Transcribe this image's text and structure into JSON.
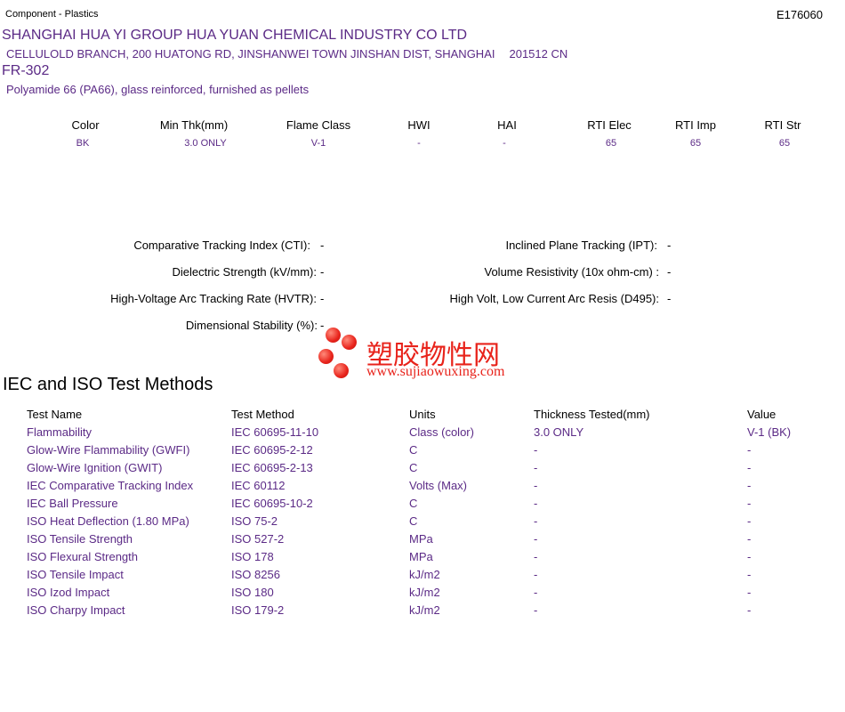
{
  "header": {
    "category": "Component - Plastics",
    "file_number": "E176060"
  },
  "company": {
    "name": "SHANGHAI HUA YI GROUP HUA YUAN CHEMICAL INDUSTRY CO LTD",
    "address": "CELLULOLD BRANCH, 200 HUATONG RD, JINSHANWEI TOWN JINSHAN DIST, SHANGHAI",
    "postal": "201512 CN"
  },
  "product": {
    "grade": "FR-302",
    "description": "Polyamide 66 (PA66), glass reinforced, furnished as pellets"
  },
  "ratings": {
    "headers": [
      "Color",
      "Min Thk(mm)",
      "Flame Class",
      "HWI",
      "HAI",
      "RTI Elec",
      "RTI Imp",
      "RTI Str"
    ],
    "values": [
      "BK",
      "3.0 ONLY",
      "V-1",
      "-",
      "-",
      "65",
      "65",
      "65"
    ]
  },
  "properties": {
    "cti_label": "Comparative Tracking Index (CTI):",
    "cti_value": "-",
    "ipt_label": "Inclined Plane Tracking (IPT):",
    "ipt_value": "-",
    "dielectric_label": "Dielectric Strength (kV/mm):",
    "dielectric_value": "-",
    "volume_label": "Volume Resistivity (10x ohm-cm) :",
    "volume_value": "-",
    "hvtr_label": "High-Voltage Arc Tracking Rate (HVTR):",
    "hvtr_value": "-",
    "d495_label": "High Volt, Low Current Arc Resis (D495):",
    "d495_value": "-",
    "dimensional_label": "Dimensional Stability (%):",
    "dimensional_value": "-"
  },
  "iec_section": {
    "title": "IEC and ISO Test Methods",
    "headers": {
      "name": "Test Name",
      "method": "Test Method",
      "units": "Units",
      "thickness": "Thickness Tested(mm)",
      "value": "Value"
    },
    "rows": [
      {
        "name": "Flammability",
        "method": "IEC 60695-11-10",
        "units": "Class (color)",
        "thickness": "3.0 ONLY",
        "value": "V-1 (BK)"
      },
      {
        "name": "Glow-Wire Flammability (GWFI)",
        "method": "IEC 60695-2-12",
        "units": "C",
        "thickness": "-",
        "value": "-"
      },
      {
        "name": "Glow-Wire Ignition (GWIT)",
        "method": "IEC 60695-2-13",
        "units": "C",
        "thickness": "-",
        "value": "-"
      },
      {
        "name": "IEC Comparative Tracking Index",
        "method": "IEC 60112",
        "units": "Volts (Max)",
        "thickness": "-",
        "value": "-"
      },
      {
        "name": "IEC Ball Pressure",
        "method": "IEC 60695-10-2",
        "units": "C",
        "thickness": "-",
        "value": "-"
      },
      {
        "name": "ISO Heat Deflection (1.80 MPa)",
        "method": "ISO 75-2",
        "units": "C",
        "thickness": "-",
        "value": "-"
      },
      {
        "name": "ISO Tensile Strength",
        "method": "ISO 527-2",
        "units": "MPa",
        "thickness": "-",
        "value": "-"
      },
      {
        "name": "ISO Flexural Strength",
        "method": "ISO 178",
        "units": "MPa",
        "thickness": "-",
        "value": "-"
      },
      {
        "name": "ISO Tensile Impact",
        "method": "ISO 8256",
        "units": "kJ/m2",
        "thickness": "-",
        "value": "-"
      },
      {
        "name": "ISO Izod Impact",
        "method": "ISO 180",
        "units": "kJ/m2",
        "thickness": "-",
        "value": "-"
      },
      {
        "name": "ISO Charpy Impact",
        "method": "ISO 179-2",
        "units": "kJ/m2",
        "thickness": "-",
        "value": "-"
      }
    ]
  },
  "watermark": {
    "cn_text": "塑胶物性网",
    "url": "www.sujiaowuxing.com"
  },
  "colors": {
    "accent": "#5b2a86",
    "watermark": "#e8231b"
  }
}
